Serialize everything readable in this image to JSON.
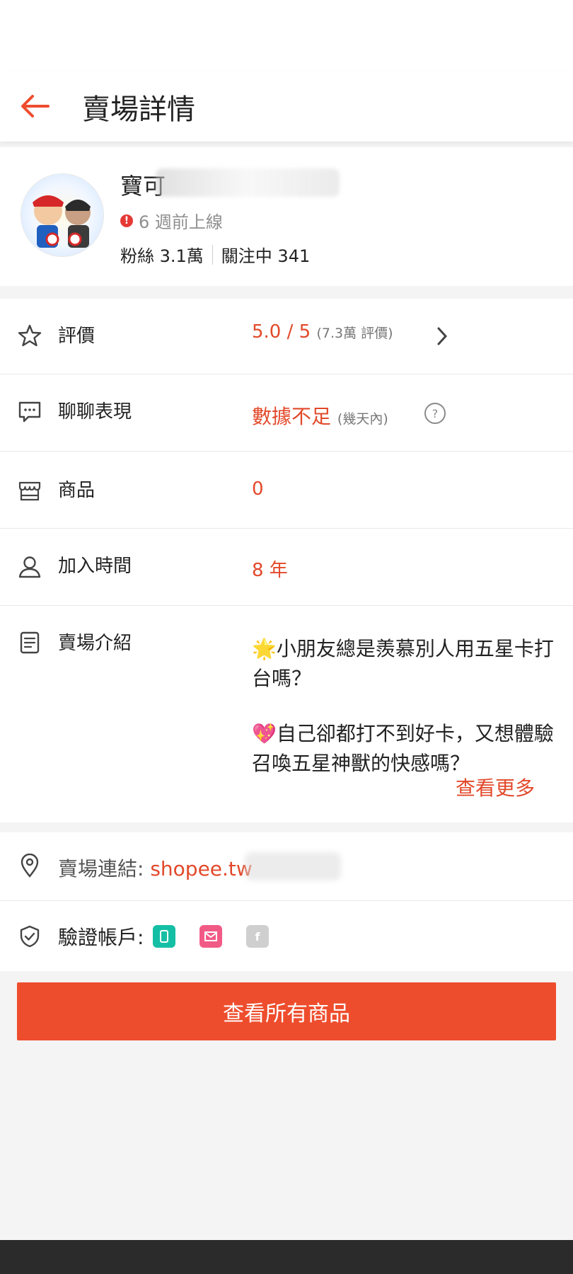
{
  "header": {
    "title": "賣場詳情"
  },
  "profile": {
    "shop_name": "寶可",
    "online_status": "6 週前上線",
    "followers": "粉絲 3.1萬",
    "following": "關注中 341"
  },
  "rows": {
    "rating": {
      "label": "評價",
      "value": "5.0 / 5",
      "sub": "(7.3萬 評價)"
    },
    "chat": {
      "label": "聊聊表現",
      "value": "數據不足",
      "sub": "(幾天內)"
    },
    "products": {
      "label": "商品",
      "value": "0"
    },
    "joined": {
      "label": "加入時間",
      "value": "8 年"
    },
    "intro": {
      "label": "賣場介紹",
      "p1": "🌟小朋友總是羨慕別人用五星卡打台嗎？",
      "p2": "💖自己卻都打不到好卡，又想體驗召喚五星神獸的快感嗎？",
      "see_more": "查看更多"
    }
  },
  "link": {
    "label": "賣場連結: ",
    "value": "shopee.tw"
  },
  "verify": {
    "label": "驗證帳戶:",
    "badges": [
      "phone",
      "email",
      "facebook"
    ],
    "badge_colors": [
      "#15bfa5",
      "#f25a86",
      "#cfcfcf"
    ]
  },
  "cta": {
    "label": "查看所有商品"
  },
  "colors": {
    "accent": "#ee4d2d",
    "value_text": "#e2492a"
  }
}
